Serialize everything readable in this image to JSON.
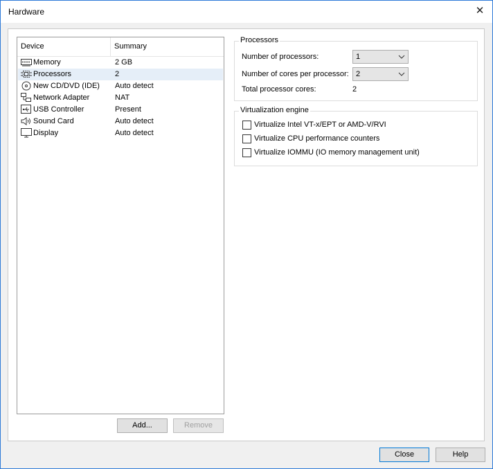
{
  "window": {
    "title": "Hardware"
  },
  "device_list": {
    "columns": {
      "device": "Device",
      "summary": "Summary"
    },
    "items": [
      {
        "name": "Memory",
        "summary": "2 GB",
        "icon": "memory-icon",
        "selected": false
      },
      {
        "name": "Processors",
        "summary": "2",
        "icon": "processor-icon",
        "selected": true
      },
      {
        "name": "New CD/DVD (IDE)",
        "summary": "Auto detect",
        "icon": "cd-dvd-icon",
        "selected": false
      },
      {
        "name": "Network Adapter",
        "summary": "NAT",
        "icon": "network-icon",
        "selected": false
      },
      {
        "name": "USB Controller",
        "summary": "Present",
        "icon": "usb-icon",
        "selected": false
      },
      {
        "name": "Sound Card",
        "summary": "Auto detect",
        "icon": "speaker-icon",
        "selected": false
      },
      {
        "name": "Display",
        "summary": "Auto detect",
        "icon": "monitor-icon",
        "selected": false
      }
    ],
    "add_label": "Add...",
    "remove_label": "Remove"
  },
  "processors": {
    "group_title": "Processors",
    "num_processors_label": "Number of processors:",
    "num_processors_value": "1",
    "cores_label": "Number of cores per processor:",
    "cores_value": "2",
    "total_label": "Total processor cores:",
    "total_value": "2"
  },
  "virtualization": {
    "group_title": "Virtualization engine",
    "options": [
      {
        "label": "Virtualize Intel VT-x/EPT or AMD-V/RVI",
        "checked": false
      },
      {
        "label": "Virtualize CPU performance counters",
        "checked": false
      },
      {
        "label": "Virtualize IOMMU (IO memory management unit)",
        "checked": false
      }
    ]
  },
  "footer": {
    "close_label": "Close",
    "help_label": "Help"
  },
  "colors": {
    "accent": "#0078d7",
    "selection": "#e5eef8"
  }
}
